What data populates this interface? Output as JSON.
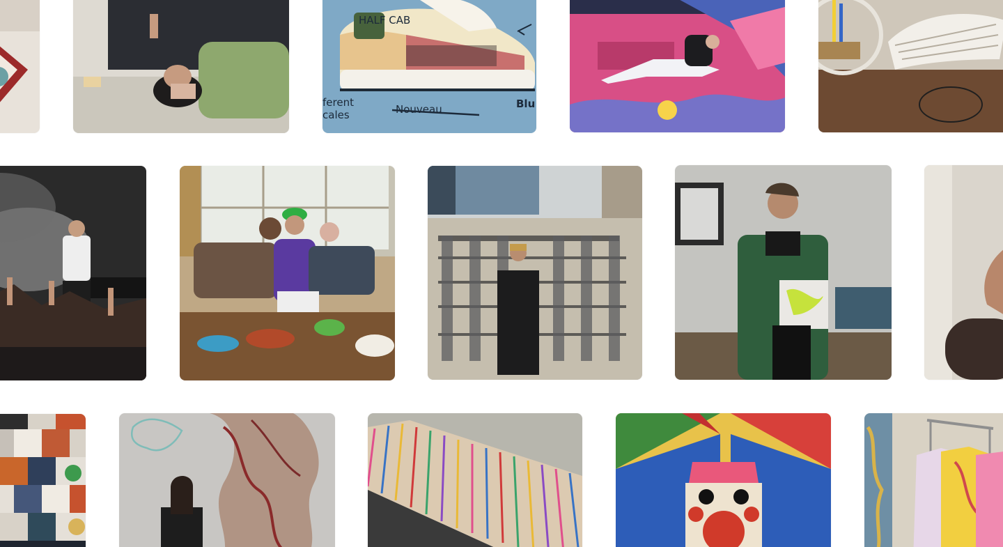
{
  "gallery": {
    "tiles": [
      {
        "id": "t1",
        "subject": "partial red and white artwork",
        "alt": "Artwork fragment"
      },
      {
        "id": "t2",
        "subject": "two people lying on floor",
        "alt": "Friends lying on the floor"
      },
      {
        "id": "t3",
        "subject": "illustrated sneaker sketch",
        "alt": "Sneaker design sketch",
        "sketch_text": {
          "logo": "HALF CAB",
          "left_line1": "ferent",
          "left_line2": "cales",
          "strike": "Nouveau",
          "right": "Blu"
        }
      },
      {
        "id": "t4",
        "subject": "person lounging on pink painted floor",
        "alt": "Person on colorful floor"
      },
      {
        "id": "t5",
        "subject": "woven hammock chair in studio",
        "alt": "Woven chair in workshop"
      },
      {
        "id": "t6",
        "subject": "performer on stage with crowd",
        "alt": "Live performance"
      },
      {
        "id": "t7",
        "subject": "three friends on couch with food",
        "alt": "Friends sharing a meal"
      },
      {
        "id": "t8",
        "subject": "person standing on rooftop with buildings",
        "alt": "Rooftop portrait"
      },
      {
        "id": "t9",
        "subject": "person holding record in living room",
        "alt": "Holding a record"
      },
      {
        "id": "t10",
        "subject": "partial portrait with raised arm",
        "alt": "Portrait fragment"
      },
      {
        "id": "t11",
        "subject": "patchwork quilt",
        "alt": "Patchwork quilt"
      },
      {
        "id": "t12",
        "subject": "artist standing beside sculpture",
        "alt": "Artist with sculpture"
      },
      {
        "id": "t13",
        "subject": "striped layered wood sculpture",
        "alt": "Layered wood sculpture"
      },
      {
        "id": "t14",
        "subject": "colorful painting of face",
        "alt": "Colorful painted face"
      },
      {
        "id": "t15",
        "subject": "clothing rack with printed shirts",
        "alt": "Clothing rack"
      }
    ]
  },
  "colors": {
    "background": "#ffffff",
    "sky_blue": "#7fa9c6",
    "pink_floor": "#d84f86",
    "green_jacket": "#2f5e3d"
  }
}
